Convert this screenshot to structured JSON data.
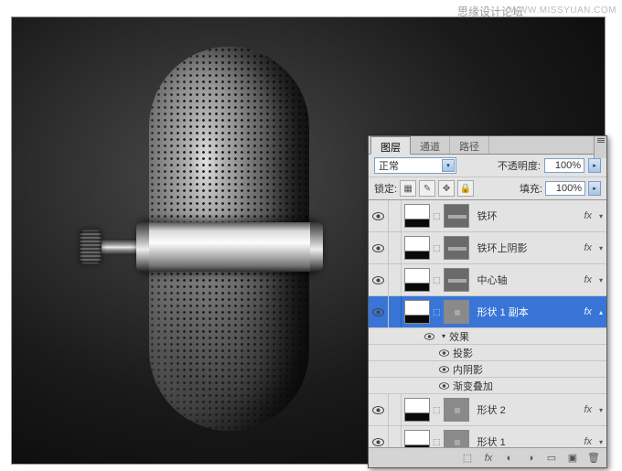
{
  "watermark": {
    "site": "思缘设计论坛",
    "url": "WWW.MISSYUAN.COM"
  },
  "tabs": {
    "layers": "图层",
    "channels": "通道",
    "paths": "路径"
  },
  "controls": {
    "blendMode": "正常",
    "opacityLabel": "不透明度:",
    "opacityValue": "100%",
    "lockLabel": "锁定:",
    "fillLabel": "填充:",
    "fillValue": "100%"
  },
  "layers": [
    {
      "name": "铁环",
      "hasFx": true,
      "mask": "bar"
    },
    {
      "name": "铁环上阴影",
      "hasFx": true,
      "mask": "bar"
    },
    {
      "name": "中心轴",
      "hasFx": true,
      "mask": "bar"
    },
    {
      "name": "形状 1 副本",
      "hasFx": true,
      "mask": "dot",
      "selected": true,
      "expanded": true
    },
    {
      "name": "形状 2",
      "hasFx": true,
      "mask": "dot"
    },
    {
      "name": "形状 1",
      "hasFx": true,
      "mask": "dot"
    }
  ],
  "effects": {
    "group": "效果",
    "items": [
      "投影",
      "内阴影",
      "渐变叠加"
    ]
  }
}
